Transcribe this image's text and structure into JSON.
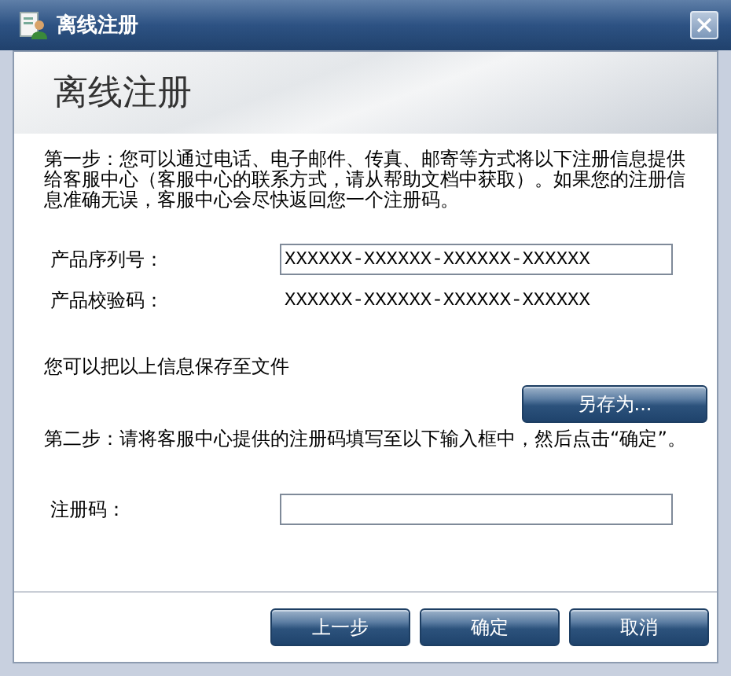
{
  "window": {
    "title": "离线注册"
  },
  "header": {
    "title": "离线注册"
  },
  "step1": "第一步：您可以通过电话、电子邮件、传真、邮寄等方式将以下注册信息提供给客服中心（客服中心的联系方式，请从帮助文档中获取）。如果您的注册信息准确无误，客服中心会尽快返回您一个注册码。",
  "fields": [
    {
      "label": "产品序列号：",
      "kind": "input",
      "value": "XXXXXX-XXXXXX-XXXXXX-XXXXXX"
    },
    {
      "label": "产品校验码：",
      "kind": "text",
      "value": "XXXXXX-XXXXXX-XXXXXX-XXXXXX"
    }
  ],
  "save_hint": "您可以把以上信息保存至文件",
  "save_button": "另存为...",
  "step2": "第二步：请将客服中心提供的注册码填写至以下输入框中，然后点击“确定”。",
  "registration_field": {
    "label": "注册码："
  },
  "buttons": [
    "上一步",
    "确定",
    "取消"
  ]
}
